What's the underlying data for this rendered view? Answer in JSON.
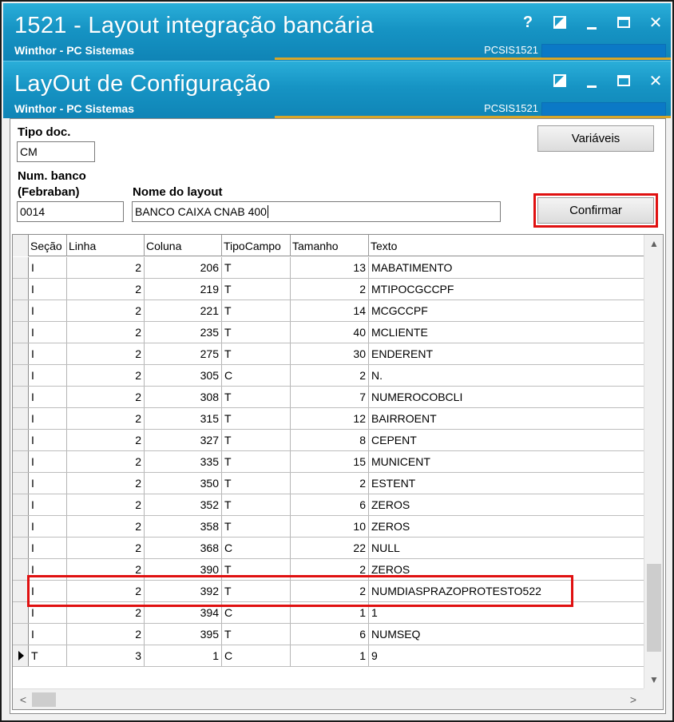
{
  "outer_window": {
    "title": "1521 - Layout integração bancária",
    "subtitle": "Winthor - PC Sistemas",
    "code": "PCSIS1521",
    "help_glyph": "?",
    "close_glyph": "✕"
  },
  "inner_window": {
    "title": "LayOut de Configuração",
    "subtitle": "Winthor - PC Sistemas",
    "code": "PCSIS1521",
    "close_glyph": "✕"
  },
  "form": {
    "tipo_doc_label": "Tipo doc.",
    "tipo_doc_value": "CM",
    "num_banco_label_1": "Num. banco",
    "num_banco_label_2": "(Febraban)",
    "num_banco_value": "0014",
    "nome_layout_label": "Nome do layout",
    "nome_layout_value": "BANCO CAIXA CNAB 400",
    "variaveis_label": "Variáveis",
    "confirmar_label": "Confirmar"
  },
  "grid": {
    "columns": [
      "Seção",
      "Linha",
      "Coluna",
      "TipoCampo",
      "Tamanho",
      "Texto"
    ],
    "rows": [
      [
        "I",
        "2",
        "206",
        "T",
        "13",
        "MABATIMENTO"
      ],
      [
        "I",
        "2",
        "219",
        "T",
        "2",
        "MTIPOCGCCPF"
      ],
      [
        "I",
        "2",
        "221",
        "T",
        "14",
        "MCGCCPF"
      ],
      [
        "I",
        "2",
        "235",
        "T",
        "40",
        "MCLIENTE"
      ],
      [
        "I",
        "2",
        "275",
        "T",
        "30",
        "ENDERENT"
      ],
      [
        "I",
        "2",
        "305",
        "C",
        "2",
        "N."
      ],
      [
        "I",
        "2",
        "308",
        "T",
        "7",
        "NUMEROCOBCLI"
      ],
      [
        "I",
        "2",
        "315",
        "T",
        "12",
        "BAIRROENT"
      ],
      [
        "I",
        "2",
        "327",
        "T",
        "8",
        "CEPENT"
      ],
      [
        "I",
        "2",
        "335",
        "T",
        "15",
        "MUNICENT"
      ],
      [
        "I",
        "2",
        "350",
        "T",
        "2",
        "ESTENT"
      ],
      [
        "I",
        "2",
        "352",
        "T",
        "6",
        "ZEROS"
      ],
      [
        "I",
        "2",
        "358",
        "T",
        "10",
        "ZEROS"
      ],
      [
        "I",
        "2",
        "368",
        "C",
        "22",
        "NULL"
      ],
      [
        "I",
        "2",
        "390",
        "T",
        "2",
        "ZEROS"
      ],
      [
        "I",
        "2",
        "392",
        "T",
        "2",
        "NUMDIASPRAZOPROTESTO522"
      ],
      [
        "I",
        "2",
        "394",
        "C",
        "1",
        "1"
      ],
      [
        "I",
        "2",
        "395",
        "T",
        "6",
        "NUMSEQ"
      ],
      [
        "T",
        "3",
        "1",
        "C",
        "1",
        "9"
      ]
    ],
    "current_row": 18,
    "highlighted_row": 15,
    "scroll_up_glyph": "▲",
    "scroll_down_glyph": "▼",
    "scroll_left_glyph": "<",
    "scroll_right_glyph": ">"
  },
  "colors": {
    "titlebar": "#1694c4",
    "highlight": "#e01010",
    "accent_line": "#d7a62a"
  }
}
